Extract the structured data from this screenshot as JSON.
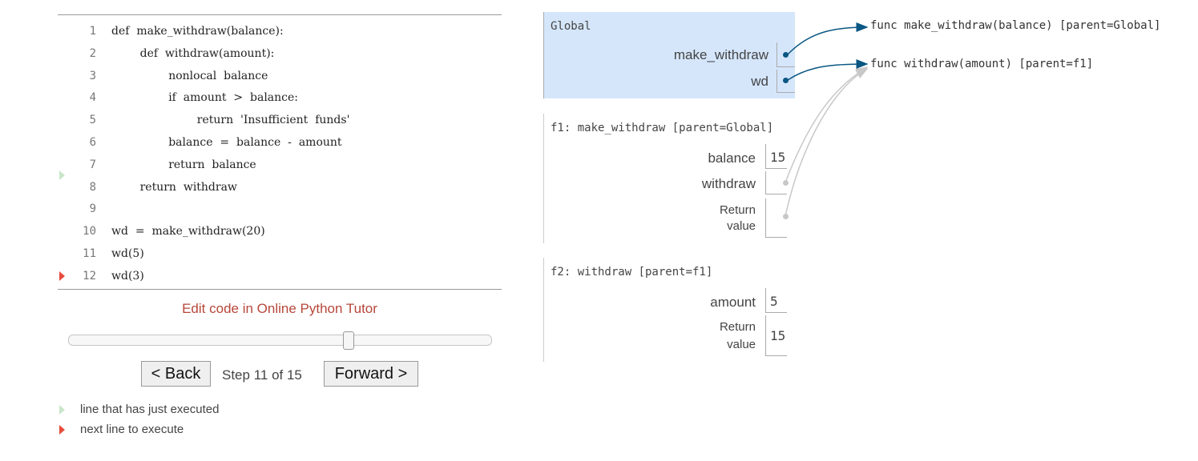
{
  "code": {
    "lines": [
      {
        "n": "1",
        "text": "def  make_withdraw(balance):"
      },
      {
        "n": "2",
        "text": "        def  withdraw(amount):"
      },
      {
        "n": "3",
        "text": "                nonlocal  balance"
      },
      {
        "n": "4",
        "text": "                if  amount  >  balance:"
      },
      {
        "n": "5",
        "text": "                        return  'Insufficient  funds'"
      },
      {
        "n": "6",
        "text": "                balance  =  balance  -  amount"
      },
      {
        "n": "7",
        "text": "                return  balance"
      },
      {
        "n": "8",
        "text": "        return  withdraw"
      },
      {
        "n": "9",
        "text": ""
      },
      {
        "n": "10",
        "text": "wd  =  make_withdraw(20)"
      },
      {
        "n": "11",
        "text": "wd(5)"
      },
      {
        "n": "12",
        "text": "wd(3)"
      }
    ]
  },
  "edit_link": "Edit code in Online Python Tutor",
  "slider_position": 0.66,
  "nav": {
    "back": "< Back",
    "step": "Step 11 of 15",
    "forward": "Forward >"
  },
  "legend": {
    "just_executed": "line that has just executed",
    "next_line": "next line to execute"
  },
  "colors": {
    "global_bg": "#d5e6fb",
    "pointer": "#0a5783",
    "pointer_light": "#c8c8c8",
    "next_arrow": "#e74c3c",
    "prev_arrow": "#c9e6c9",
    "link": "#b7473a"
  },
  "frames": {
    "global": {
      "title": "Global",
      "vars": [
        {
          "name": "make_withdraw",
          "value": ""
        },
        {
          "name": "wd",
          "value": ""
        }
      ]
    },
    "f1": {
      "title": "f1: make_withdraw [parent=Global]",
      "vars": [
        {
          "name": "balance",
          "value": "15"
        },
        {
          "name": "withdraw",
          "value": ""
        }
      ],
      "return_label_1": "Return",
      "return_label_2": "value",
      "return_value": ""
    },
    "f2": {
      "title": "f2: withdraw [parent=f1]",
      "vars": [
        {
          "name": "amount",
          "value": "5"
        }
      ],
      "return_label_1": "Return",
      "return_label_2": "value",
      "return_value": "15"
    }
  },
  "objects": {
    "func1": "func make_withdraw(balance) [parent=Global]",
    "func2": "func withdraw(amount) [parent=f1]"
  }
}
